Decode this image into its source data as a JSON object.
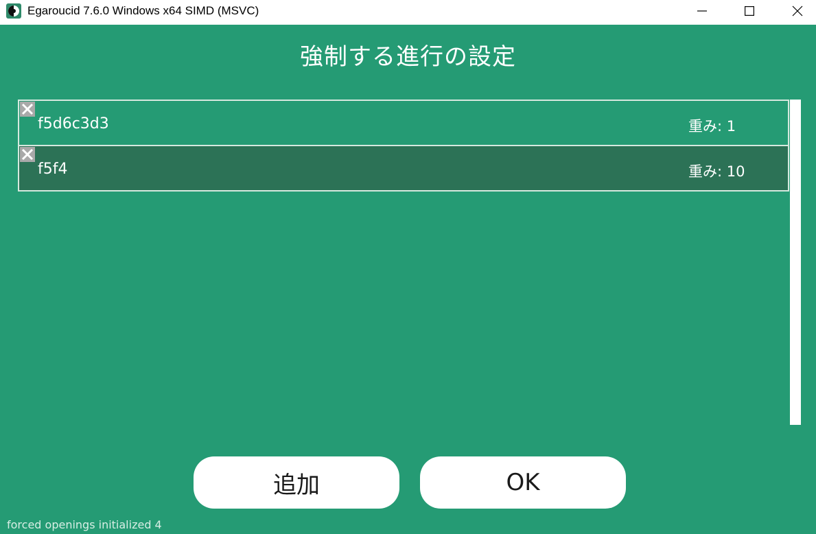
{
  "window": {
    "title": "Egaroucid 7.6.0 Windows x64 SIMD (MSVC)",
    "controls": [
      "minimize-icon",
      "maximize-icon",
      "close-icon"
    ]
  },
  "page": {
    "title": "強制する進行の設定"
  },
  "openings": [
    {
      "moves": "f5d6c3d3",
      "weight": "重み: 1",
      "selected": false
    },
    {
      "moves": "f5f4",
      "weight": "重み: 10",
      "selected": true
    }
  ],
  "buttons": {
    "add_label": "追加",
    "ok_label": "OK"
  },
  "status": {
    "text": "forced openings initialized 4"
  },
  "colors": {
    "background": "#259b74",
    "selected_row": "#2c7256",
    "row_border": "#d6e9df",
    "delete_icon_bg": "#a9a9a9"
  }
}
